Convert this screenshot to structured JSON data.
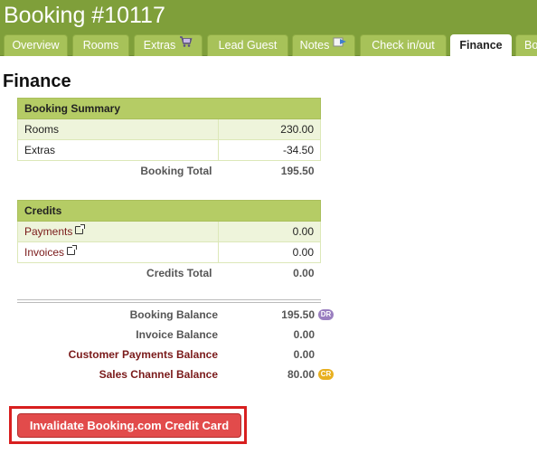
{
  "header": {
    "title": "Booking #10117"
  },
  "tabs": [
    {
      "label": "Overview"
    },
    {
      "label": "Rooms"
    },
    {
      "label": "Extras",
      "icon": "cart-icon"
    },
    {
      "label": "Lead Guest"
    },
    {
      "label": "Notes",
      "icon": "notes-arrow-icon"
    },
    {
      "label": "Check in/out"
    },
    {
      "label": "Finance",
      "active": true
    },
    {
      "label": "Bo"
    }
  ],
  "section_title": "Finance",
  "booking_summary": {
    "heading": "Booking Summary",
    "rows": [
      {
        "label": "Rooms",
        "value": "230.00"
      },
      {
        "label": "Extras",
        "value": "-34.50"
      }
    ],
    "total_label": "Booking Total",
    "total_value": "195.50"
  },
  "credits": {
    "heading": "Credits",
    "rows": [
      {
        "label": "Payments",
        "value": "0.00"
      },
      {
        "label": "Invoices",
        "value": "0.00"
      }
    ],
    "total_label": "Credits Total",
    "total_value": "0.00"
  },
  "balances": [
    {
      "label": "Booking Balance",
      "value": "195.50",
      "badge": "DR"
    },
    {
      "label": "Invoice Balance",
      "value": "0.00"
    },
    {
      "label": "Customer Payments Balance",
      "value": "0.00"
    },
    {
      "label": "Sales Channel Balance",
      "value": "80.00",
      "badge": "CR"
    }
  ],
  "invalidate_button": {
    "label": "Invalidate Booking.com Credit Card"
  },
  "colors": {
    "brand_green": "#7f9f3a",
    "tab_green": "#a7c259",
    "header_row": "#b5cc65",
    "button_red": "#e24b4b",
    "highlight_red": "#d81f1f"
  }
}
